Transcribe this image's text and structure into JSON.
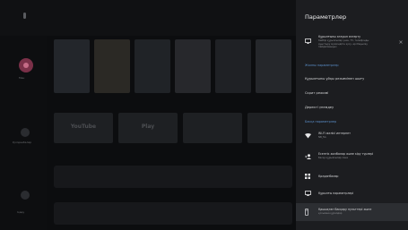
{
  "panel": {
    "title": "Параметрлер",
    "items": {
      "nearby": {
        "label": "Құрылғыны атауын өзгерту",
        "sub1": "Кейбір құрылғылар үшін, TV, телефонды",
        "sub2": "ауыстыру мүмкіндігін қосу, әрі бақылау",
        "sub3": "пайдаланыңыз"
      },
      "section1": "Жалпы параметрлер",
      "apps_off": "Құрылғыны ұйқы режимінен шығу",
      "screensaver": "Скрит режимі",
      "data_saver": "Деректі үнемдеу",
      "section2": "Басқа параметрлер",
      "wifi": {
        "label": "Wi-Fi желісі интернет",
        "sub": "NB_5G"
      },
      "remotes": {
        "label": "Есептік жазбалар және кіру түрлері",
        "sub": "Басқа құрылғылар ғана"
      },
      "apps": "Қолданбалар",
      "device": "Құрылғы параметрлері",
      "remote_acc": {
        "label": "Қашықтан басқару пульттері және",
        "sub": "қосымша құралдар"
      }
    }
  },
  "home": {
    "rail_labels": [
      "Мен",
      "Қолданбалар",
      "Іздеу"
    ],
    "app_tiles": [
      "YouTube",
      "Play",
      "",
      ""
    ]
  }
}
